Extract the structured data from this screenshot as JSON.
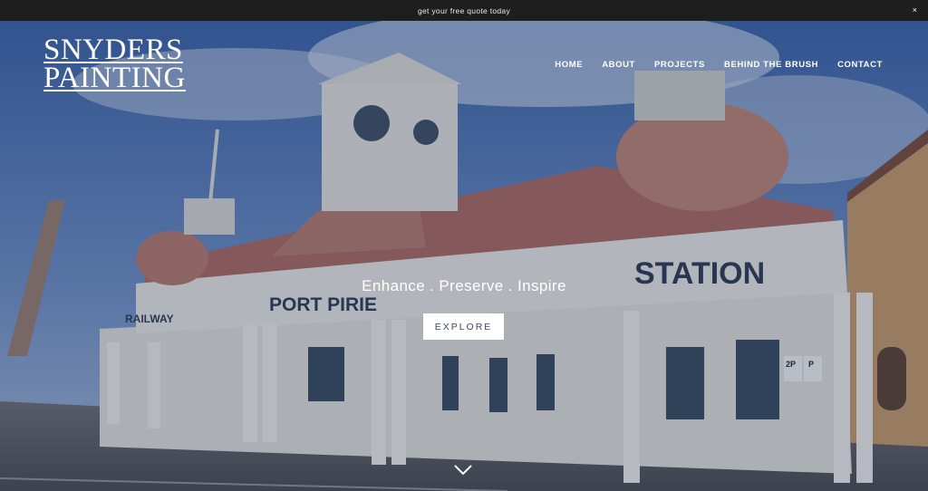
{
  "announcement": {
    "text": "get your free quote today",
    "close_label": "×"
  },
  "logo": {
    "line1": "SNYDERS",
    "line2": "PAINTING"
  },
  "nav": {
    "items": [
      "HOME",
      "ABOUT",
      "PROJECTS",
      "BEHIND THE BRUSH",
      "CONTACT"
    ]
  },
  "hero": {
    "tagline": "Enhance . Preserve . Inspire",
    "button_label": "EXPLORE"
  },
  "sign_texts": {
    "station": "STATION",
    "port_pirie": "PORT PIRIE",
    "railway": "RAILWAY",
    "parking_2p": "2P",
    "parking_p": "P"
  },
  "icons": {
    "scroll": "chevron-down-icon",
    "close": "close-icon"
  },
  "colors": {
    "topbar": "#1e1e1e",
    "button_bg": "#ffffff",
    "button_text": "#3a4a64",
    "roof": "#b06860",
    "wall": "#e6e6e2"
  }
}
